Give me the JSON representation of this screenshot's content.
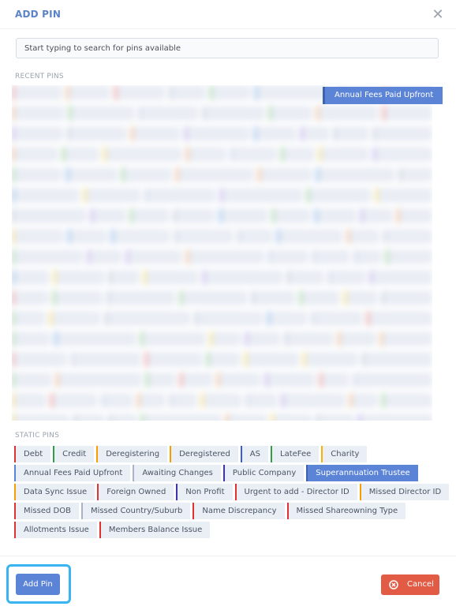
{
  "header": {
    "title": "ADD PIN",
    "close_icon": "close-icon"
  },
  "search": {
    "placeholder": "Start typing to search for pins available",
    "value": ""
  },
  "recent": {
    "label": "RECENT PINS",
    "featured": {
      "label": "Annual Fees Paid Upfront",
      "color": "#5b83d6"
    }
  },
  "static": {
    "label": "STATIC PINS",
    "rows": [
      [
        {
          "label": "Debt",
          "color": "#e03131"
        },
        {
          "label": "Credit",
          "color": "#2f9e44"
        },
        {
          "label": "Deregistering",
          "color": "#f59f00"
        },
        {
          "label": "Deregistered",
          "color": "#f59f00"
        },
        {
          "label": "AS",
          "color": "#3b5bdb"
        },
        {
          "label": "LateFee",
          "color": "#2f9e44"
        },
        {
          "label": "Charity",
          "color": "#fab005"
        }
      ],
      [
        {
          "label": "Annual Fees Paid Upfront",
          "color": "#5b83d6"
        },
        {
          "label": "Awaiting Changes",
          "color": "#a5b4c9"
        },
        {
          "label": "Public Company",
          "color": "#3b2fdb"
        },
        {
          "label": "Superannuation Trustee",
          "color": "#3d63b0",
          "selected": true
        }
      ],
      [
        {
          "label": "Data Sync Issue",
          "color": "#f59f00"
        },
        {
          "label": "Foreign Owned",
          "color": "#e03131"
        },
        {
          "label": "Non Profit",
          "color": "#3b2fdb"
        },
        {
          "label": "Urgent to add - Director ID",
          "color": "#e03131"
        },
        {
          "label": "Missed Director ID",
          "color": "#f59f00"
        }
      ],
      [
        {
          "label": "Missed DOB",
          "color": "#e03131"
        },
        {
          "label": "Missed Country/Suburb",
          "color": "#a5b4c9"
        },
        {
          "label": "Name Discrepancy",
          "color": "#e03131"
        },
        {
          "label": "Missed Shareowning Type",
          "color": "#e03131"
        }
      ],
      [
        {
          "label": "Allotments Issue",
          "color": "#e03131"
        },
        {
          "label": "Members Balance Issue",
          "color": "#e03131"
        }
      ]
    ]
  },
  "footer": {
    "add_label": "Add Pin",
    "cancel_label": "Cancel",
    "cancel_icon": "cancel-circle-icon",
    "add_color": "#5b83d6",
    "cancel_color": "#e25b45"
  }
}
